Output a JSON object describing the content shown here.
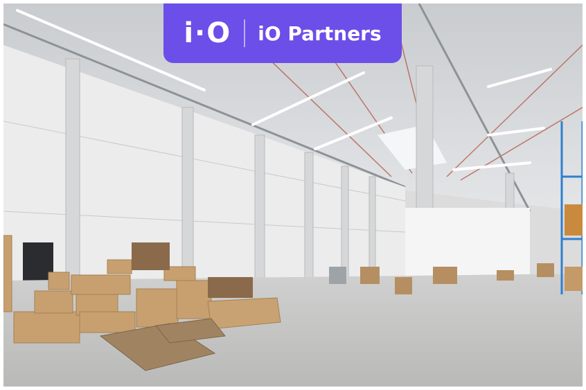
{
  "brand": {
    "mark": "i·O",
    "name": "iO Partners",
    "color": "#6c4ee8"
  },
  "photo": {
    "subject": "empty-warehouse-interior"
  }
}
